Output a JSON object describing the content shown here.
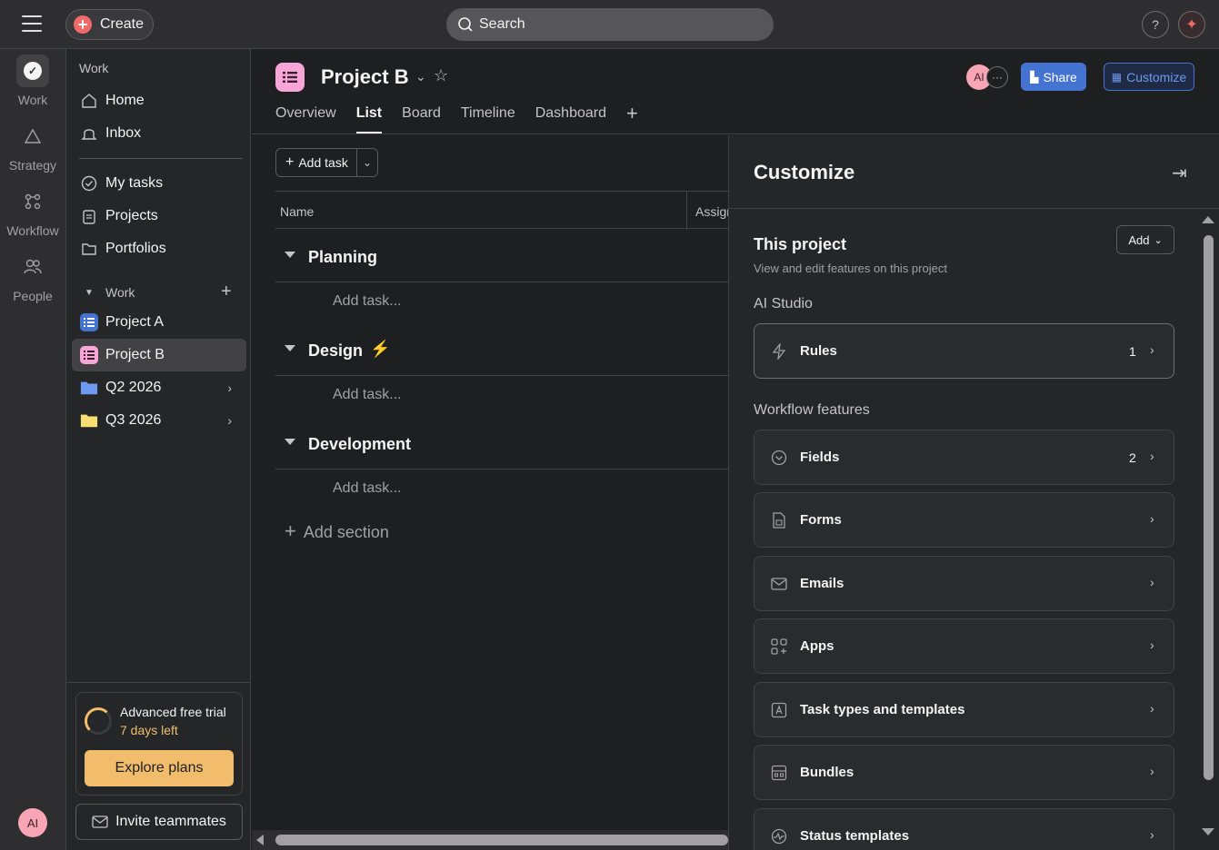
{
  "topbar": {
    "create_label": "Create",
    "search_placeholder": "Search",
    "help_label": "?"
  },
  "rail": {
    "items": [
      {
        "label": "Work",
        "icon": "check-icon"
      },
      {
        "label": "Strategy",
        "icon": "triangle-icon"
      },
      {
        "label": "Workflow",
        "icon": "workflow-icon"
      },
      {
        "label": "People",
        "icon": "people-icon"
      }
    ],
    "avatar_initials": "AI"
  },
  "sidebar": {
    "heading": "Work",
    "nav": [
      {
        "label": "Home",
        "icon": "home-icon"
      },
      {
        "label": "Inbox",
        "icon": "bell-icon"
      }
    ],
    "nav2": [
      {
        "label": "My tasks",
        "icon": "check-circle-icon"
      },
      {
        "label": "Projects",
        "icon": "clipboard-icon"
      },
      {
        "label": "Portfolios",
        "icon": "folder-icon"
      }
    ],
    "team_heading": "Work",
    "projects": [
      {
        "label": "Project A",
        "color": "#4573d2"
      },
      {
        "label": "Project B",
        "color": "#f8a5d8"
      }
    ],
    "folders": [
      {
        "label": "Q2 2026",
        "color": "#6d9af0"
      },
      {
        "label": "Q3 2026",
        "color": "#f8df72"
      }
    ],
    "trial_title": "Advanced free trial",
    "trial_days": "7 days left",
    "explore_label": "Explore plans",
    "invite_label": "Invite teammates"
  },
  "header": {
    "project_title": "Project B",
    "tabs": [
      "Overview",
      "List",
      "Board",
      "Timeline",
      "Dashboard"
    ],
    "active_tab": "List",
    "avatar_initials": "AI",
    "share_label": "Share",
    "customize_label": "Customize"
  },
  "list": {
    "add_task_label": "Add task",
    "columns": [
      "Name",
      "Assign"
    ],
    "sections": [
      {
        "title": "Planning",
        "add_task": "Add task..."
      },
      {
        "title": "Design",
        "add_task": "Add task..."
      },
      {
        "title": "Development",
        "add_task": "Add task..."
      }
    ],
    "add_section_label": "Add section"
  },
  "panel": {
    "title": "Customize",
    "project_heading": "This project",
    "project_sub": "View and edit features on this project",
    "add_label": "Add",
    "group1": "AI Studio",
    "rules": {
      "label": "Rules",
      "count": "1"
    },
    "group2": "Workflow features",
    "features": [
      {
        "label": "Fields",
        "count": "2",
        "icon": "fields-icon"
      },
      {
        "label": "Forms",
        "count": "",
        "icon": "form-icon"
      },
      {
        "label": "Emails",
        "count": "",
        "icon": "envelope-icon"
      },
      {
        "label": "Apps",
        "count": "",
        "icon": "apps-icon"
      },
      {
        "label": "Task types and templates",
        "count": "",
        "icon": "template-icon"
      },
      {
        "label": "Bundles",
        "count": "",
        "icon": "bundle-icon"
      },
      {
        "label": "Status templates",
        "count": "",
        "icon": "status-icon"
      }
    ]
  }
}
